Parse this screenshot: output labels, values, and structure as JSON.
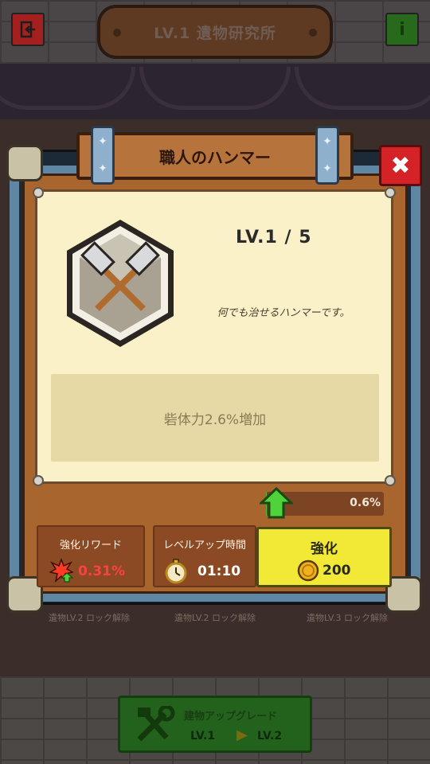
{
  "header": {
    "title": "LV.1 遺物研究所",
    "exit_icon": "exit-door-icon",
    "info_icon": "info-icon",
    "info_label": "i"
  },
  "dialog": {
    "name": "職人のハンマー",
    "level": "LV.1 / 5",
    "description": "何でも治せるハンマーです。",
    "effect": "砦体力2.6%増加",
    "progress": {
      "value_text": "0.6%",
      "fraction": 0.006
    },
    "reward": {
      "label": "強化リワード",
      "value": "0.31%"
    },
    "levelup_time": {
      "label": "レベルアップ時間",
      "value": "01:10"
    },
    "enhance_button": {
      "label": "強化",
      "cost": "200"
    },
    "close_label": "✖"
  },
  "background": {
    "behind_labels": [
      "遺物LV.2 ロック解除",
      "遺物LV.2 ロック解除",
      "遺物LV.3 ロック解除"
    ]
  },
  "bottom": {
    "upgrade_label": "建物アップグレード",
    "from_level": "LV.1",
    "to_level": "LV.2"
  },
  "colors": {
    "close_red": "#d42227",
    "enhance_yellow": "#f2e936",
    "reward_red": "#ff4040",
    "progress_green": "#4fb63b"
  }
}
